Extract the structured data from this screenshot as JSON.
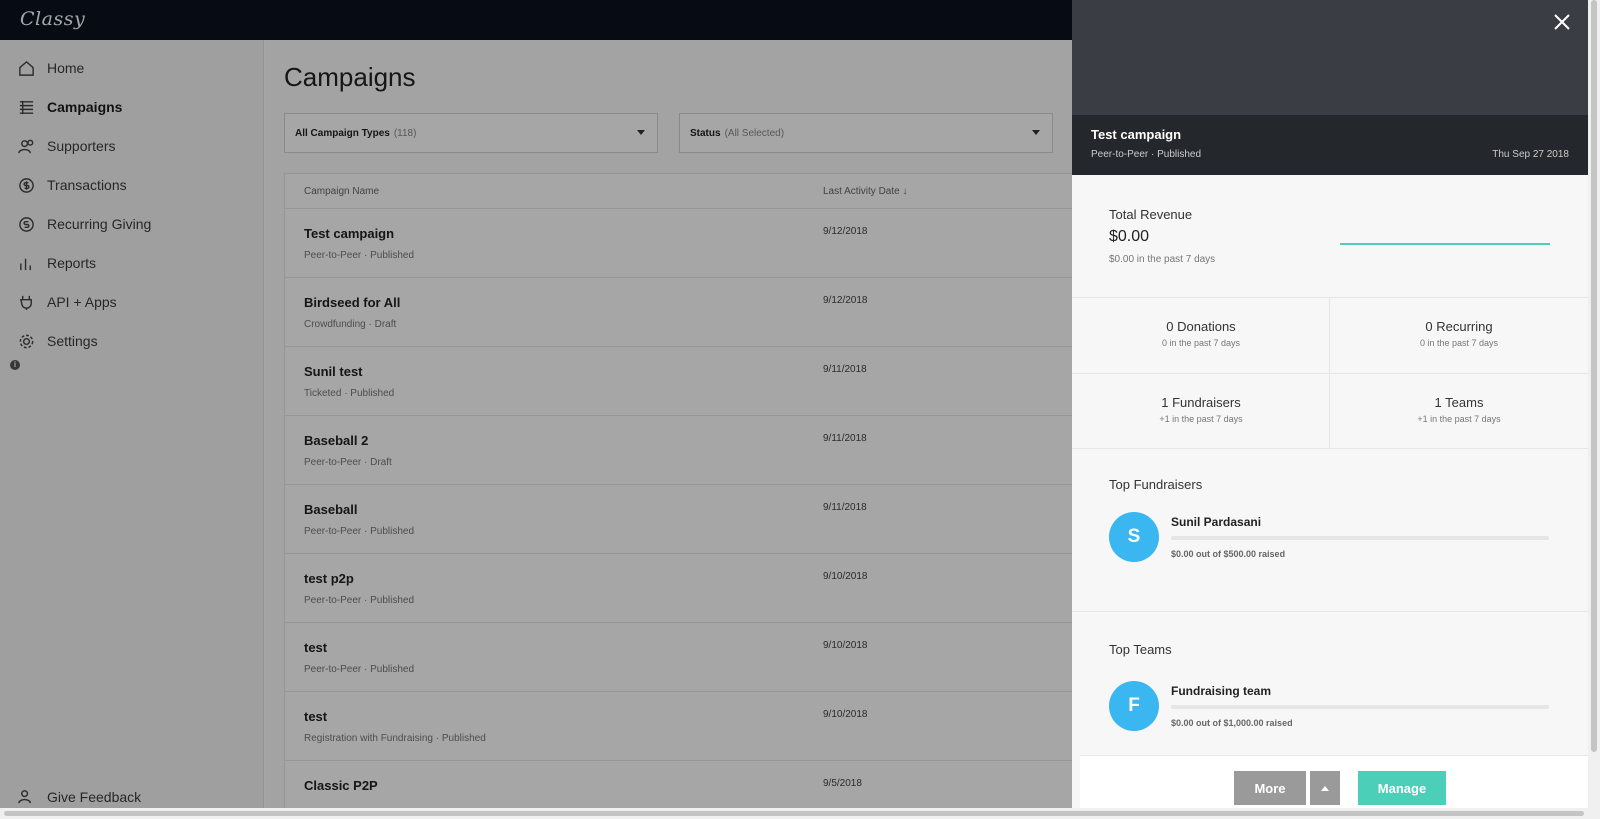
{
  "app": {
    "logo": "Classy"
  },
  "sidebar": {
    "items": [
      {
        "label": "Home",
        "icon": "home-icon"
      },
      {
        "label": "Campaigns",
        "icon": "campaigns-icon"
      },
      {
        "label": "Supporters",
        "icon": "supporters-icon"
      },
      {
        "label": "Transactions",
        "icon": "transactions-icon"
      },
      {
        "label": "Recurring Giving",
        "icon": "recurring-icon"
      },
      {
        "label": "Reports",
        "icon": "reports-icon"
      },
      {
        "label": "API + Apps",
        "icon": "plug-icon"
      },
      {
        "label": "Settings",
        "icon": "gear-icon"
      }
    ],
    "feedback": "Give Feedback"
  },
  "main": {
    "title": "Campaigns",
    "filter_types": {
      "label": "All Campaign Types",
      "count": "(118)"
    },
    "filter_status": {
      "label": "Status",
      "value": "(All Selected)"
    },
    "columns": {
      "name": "Campaign Name",
      "date": "Last Activity Date ↓"
    },
    "rows": [
      {
        "name": "Test campaign",
        "meta": "Peer-to-Peer · Published",
        "date": "9/12/2018"
      },
      {
        "name": "Birdseed for All",
        "meta": "Crowdfunding · Draft",
        "date": "9/12/2018"
      },
      {
        "name": "Sunil test",
        "meta": "Ticketed · Published",
        "date": "9/11/2018"
      },
      {
        "name": "Baseball 2",
        "meta": "Peer-to-Peer · Draft",
        "date": "9/11/2018"
      },
      {
        "name": "Baseball",
        "meta": "Peer-to-Peer · Published",
        "date": "9/11/2018"
      },
      {
        "name": "test p2p",
        "meta": "Peer-to-Peer · Published",
        "date": "9/10/2018"
      },
      {
        "name": "test",
        "meta": "Peer-to-Peer · Published",
        "date": "9/10/2018"
      },
      {
        "name": "test",
        "meta": "Registration with Fundraising · Published",
        "date": "9/10/2018"
      },
      {
        "name": "Classic P2P",
        "meta": "",
        "date": "9/5/2018"
      }
    ]
  },
  "panel": {
    "title": "Test campaign",
    "subtitle": "Peer-to-Peer · Published",
    "date": "Thu Sep 27 2018",
    "revenue": {
      "label": "Total Revenue",
      "value": "$0.00",
      "sub": "$0.00 in the past 7 days"
    },
    "stats": [
      {
        "big": "0 Donations",
        "small": "0 in the past 7 days"
      },
      {
        "big": "0 Recurring",
        "small": "0 in the past 7 days"
      },
      {
        "big": "1 Fundraisers",
        "small": "+1 in the past 7 days"
      },
      {
        "big": "1 Teams",
        "small": "+1 in the past 7 days"
      }
    ],
    "top_fundraisers": {
      "title": "Top Fundraisers",
      "items": [
        {
          "initial": "S",
          "name": "Sunil Pardasani",
          "sub": "$0.00 out of $500.00 raised",
          "progress": 0
        }
      ]
    },
    "top_teams": {
      "title": "Top Teams",
      "items": [
        {
          "initial": "F",
          "name": "Fundraising team",
          "sub": "$0.00 out of $1,000.00 raised",
          "progress": 0
        }
      ]
    },
    "buttons": {
      "more": "More",
      "manage": "Manage"
    }
  },
  "colors": {
    "accent": "#4ccfb8",
    "avatar": "#3ab6f0",
    "topbar": "#0b1220"
  }
}
